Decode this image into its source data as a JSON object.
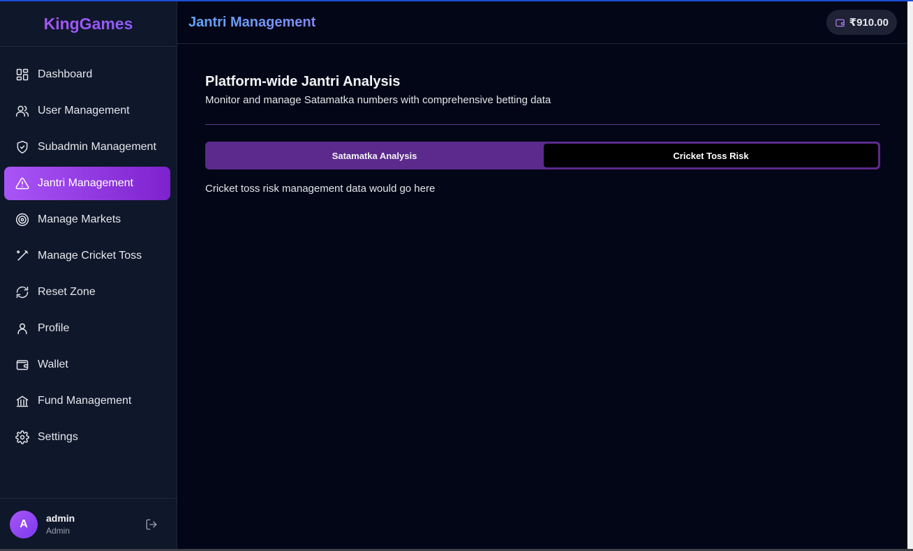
{
  "brand": {
    "name": "KingGames"
  },
  "header": {
    "title": "Jantri Management",
    "balance": "₹910.00"
  },
  "sidebar": {
    "items": [
      {
        "label": "Dashboard",
        "icon": "dashboard-icon",
        "active": false
      },
      {
        "label": "User Management",
        "icon": "users-icon",
        "active": false
      },
      {
        "label": "Subadmin Management",
        "icon": "shield-check-icon",
        "active": false
      },
      {
        "label": "Jantri Management",
        "icon": "alert-triangle-icon",
        "active": true
      },
      {
        "label": "Manage Markets",
        "icon": "target-icon",
        "active": false
      },
      {
        "label": "Manage Cricket Toss",
        "icon": "cricket-bat-icon",
        "active": false
      },
      {
        "label": "Reset Zone",
        "icon": "refresh-icon",
        "active": false
      },
      {
        "label": "Profile",
        "icon": "user-icon",
        "active": false
      },
      {
        "label": "Wallet",
        "icon": "wallet-icon",
        "active": false
      },
      {
        "label": "Fund Management",
        "icon": "bank-icon",
        "active": false
      },
      {
        "label": "Settings",
        "icon": "gear-icon",
        "active": false
      }
    ]
  },
  "user": {
    "initial": "A",
    "name": "admin",
    "role": "Admin"
  },
  "main": {
    "title": "Platform-wide Jantri Analysis",
    "subtitle": "Monitor and manage Satamatka numbers with comprehensive betting data",
    "tabs": [
      {
        "label": "Satamatka Analysis",
        "active": false
      },
      {
        "label": "Cricket Toss Risk",
        "active": true
      }
    ],
    "content": "Cricket toss risk management data would go here"
  },
  "colors": {
    "accent": "#a855f7",
    "active_tab_bg": "#000000",
    "tab_bar_bg": "#5b2a8c"
  }
}
